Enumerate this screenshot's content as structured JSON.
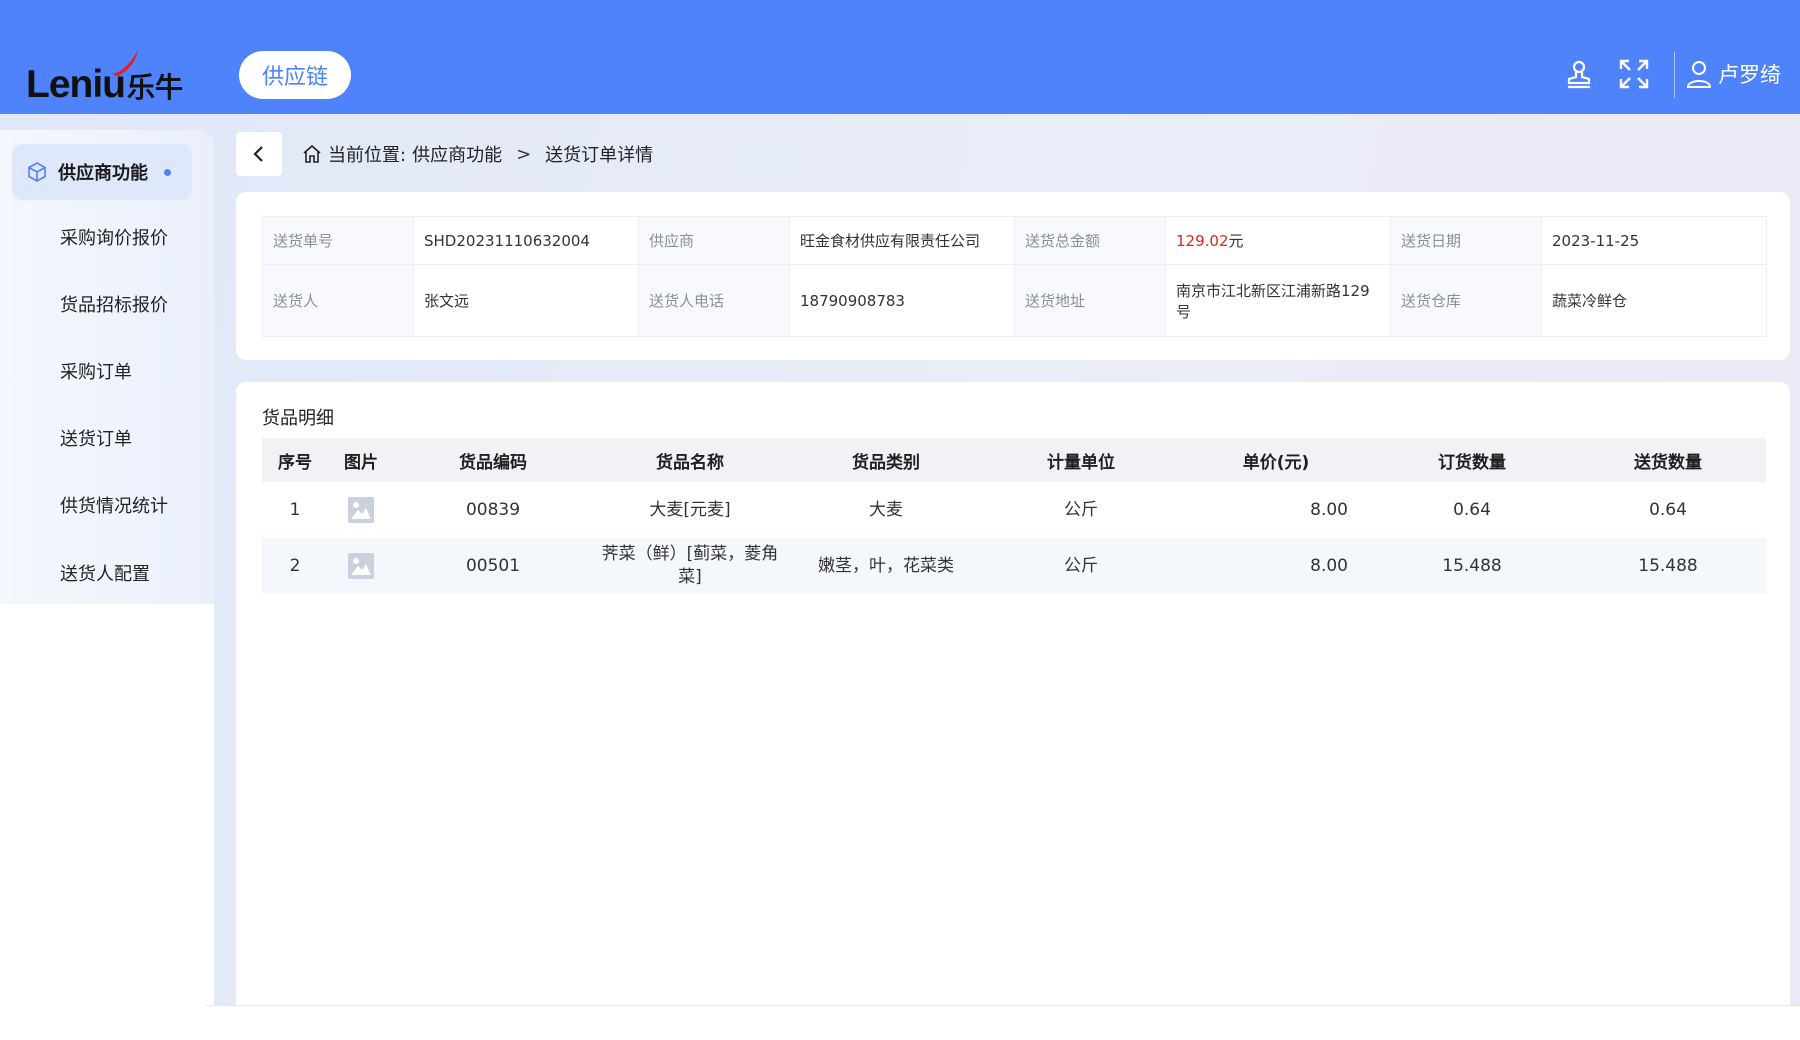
{
  "header": {
    "logo_latin": "Leniu",
    "logo_cn": "乐牛",
    "module": "供应链",
    "user_name": "卢罗绮"
  },
  "sidebar": {
    "active": "供应商功能",
    "items": [
      {
        "label": "采购询价报价"
      },
      {
        "label": "货品招标报价"
      },
      {
        "label": "采购订单"
      },
      {
        "label": "送货订单"
      },
      {
        "label": "供货情况统计"
      },
      {
        "label": "送货人配置"
      }
    ]
  },
  "breadcrumb": {
    "prefix": "当前位置:",
    "section": "供应商功能",
    "page": "送货订单详情"
  },
  "info": {
    "order_no_label": "送货单号",
    "order_no": "SHD20231110632004",
    "supplier_label": "供应商",
    "supplier": "旺金食材供应有限责任公司",
    "total_label": "送货总金额",
    "total_amount": "129.02",
    "total_unit": "元",
    "date_label": "送货日期",
    "date": "2023-11-25",
    "deliverer_label": "送货人",
    "deliverer": "张文远",
    "phone_label": "送货人电话",
    "phone": "18790908783",
    "address_label": "送货地址",
    "address": "南京市江北新区江浦新路129号",
    "warehouse_label": "送货仓库",
    "warehouse": "蔬菜冷鲜仓"
  },
  "goods": {
    "title": "货品明细",
    "columns": [
      "序号",
      "图片",
      "货品编码",
      "货品名称",
      "货品类别",
      "计量单位",
      "单价(元)",
      "订货数量",
      "送货数量"
    ],
    "rows": [
      {
        "idx": "1",
        "code": "00839",
        "name": "大麦[元麦]",
        "category": "大麦",
        "unit": "公斤",
        "price": "8.00",
        "order_qty": "0.64",
        "deliver_qty": "0.64"
      },
      {
        "idx": "2",
        "code": "00501",
        "name": "荠菜（鲜）[蓟菜，菱角菜]",
        "category": "嫩茎，叶，花菜类",
        "unit": "公斤",
        "price": "8.00",
        "order_qty": "15.488",
        "deliver_qty": "15.488"
      }
    ]
  },
  "icons": {
    "sidebar_active": "cube-icon",
    "header": [
      "stamp-icon",
      "fullscreen-icon",
      "user-icon"
    ],
    "back": "chevron-left-icon",
    "breadcrumb": "home-icon",
    "row_image": "image-placeholder-icon"
  },
  "colors": {
    "primary": "#4e83fb",
    "amount": "#e0251b"
  }
}
